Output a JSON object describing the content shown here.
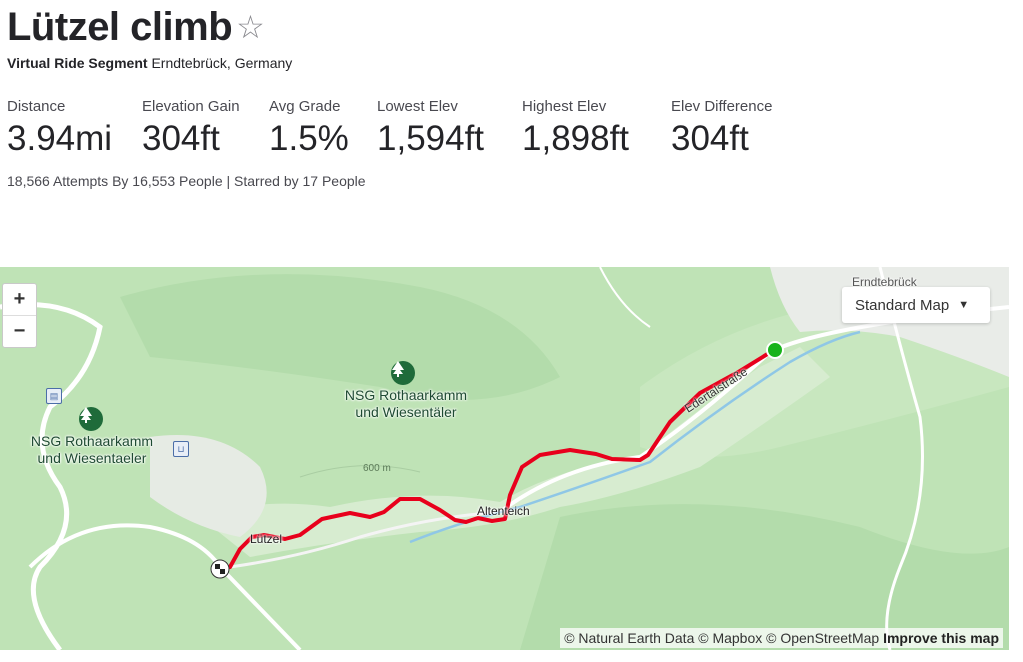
{
  "segment": {
    "title": "Lützel climb",
    "star_icon": "star-outline-icon",
    "type_label": "Virtual Ride Segment",
    "location": "Erndtebrück, Germany"
  },
  "stats": [
    {
      "label": "Distance",
      "value": "3.94mi"
    },
    {
      "label": "Elevation Gain",
      "value": "304ft"
    },
    {
      "label": "Avg Grade",
      "value": "1.5%"
    },
    {
      "label": "Lowest Elev",
      "value": "1,594ft"
    },
    {
      "label": "Highest Elev",
      "value": "1,898ft"
    },
    {
      "label": "Elev Difference",
      "value": "304ft"
    }
  ],
  "attempts_text": "18,566 Attempts By 16,553 People | Starred by 17 People",
  "map": {
    "zoom_in": "+",
    "zoom_out": "−",
    "map_type": "Standard Map",
    "labels": {
      "nsg_center": "NSG Rothaarkamm und Wiesentäler",
      "nsg_left": "NSG Rothaarkamm und Wiesentaeler",
      "luetzel": "Lützel",
      "altenteich": "Altenteich",
      "contour": "600 m",
      "road": "Edertalstraße",
      "town_partial": "Erndtebrück"
    },
    "attribution_text": "© Natural Earth Data © Mapbox © OpenStreetMap",
    "improve_link": "Improve this map",
    "colors": {
      "route": "#e8001c",
      "start": "#18b31b",
      "forest": "#bfe3b6"
    }
  }
}
